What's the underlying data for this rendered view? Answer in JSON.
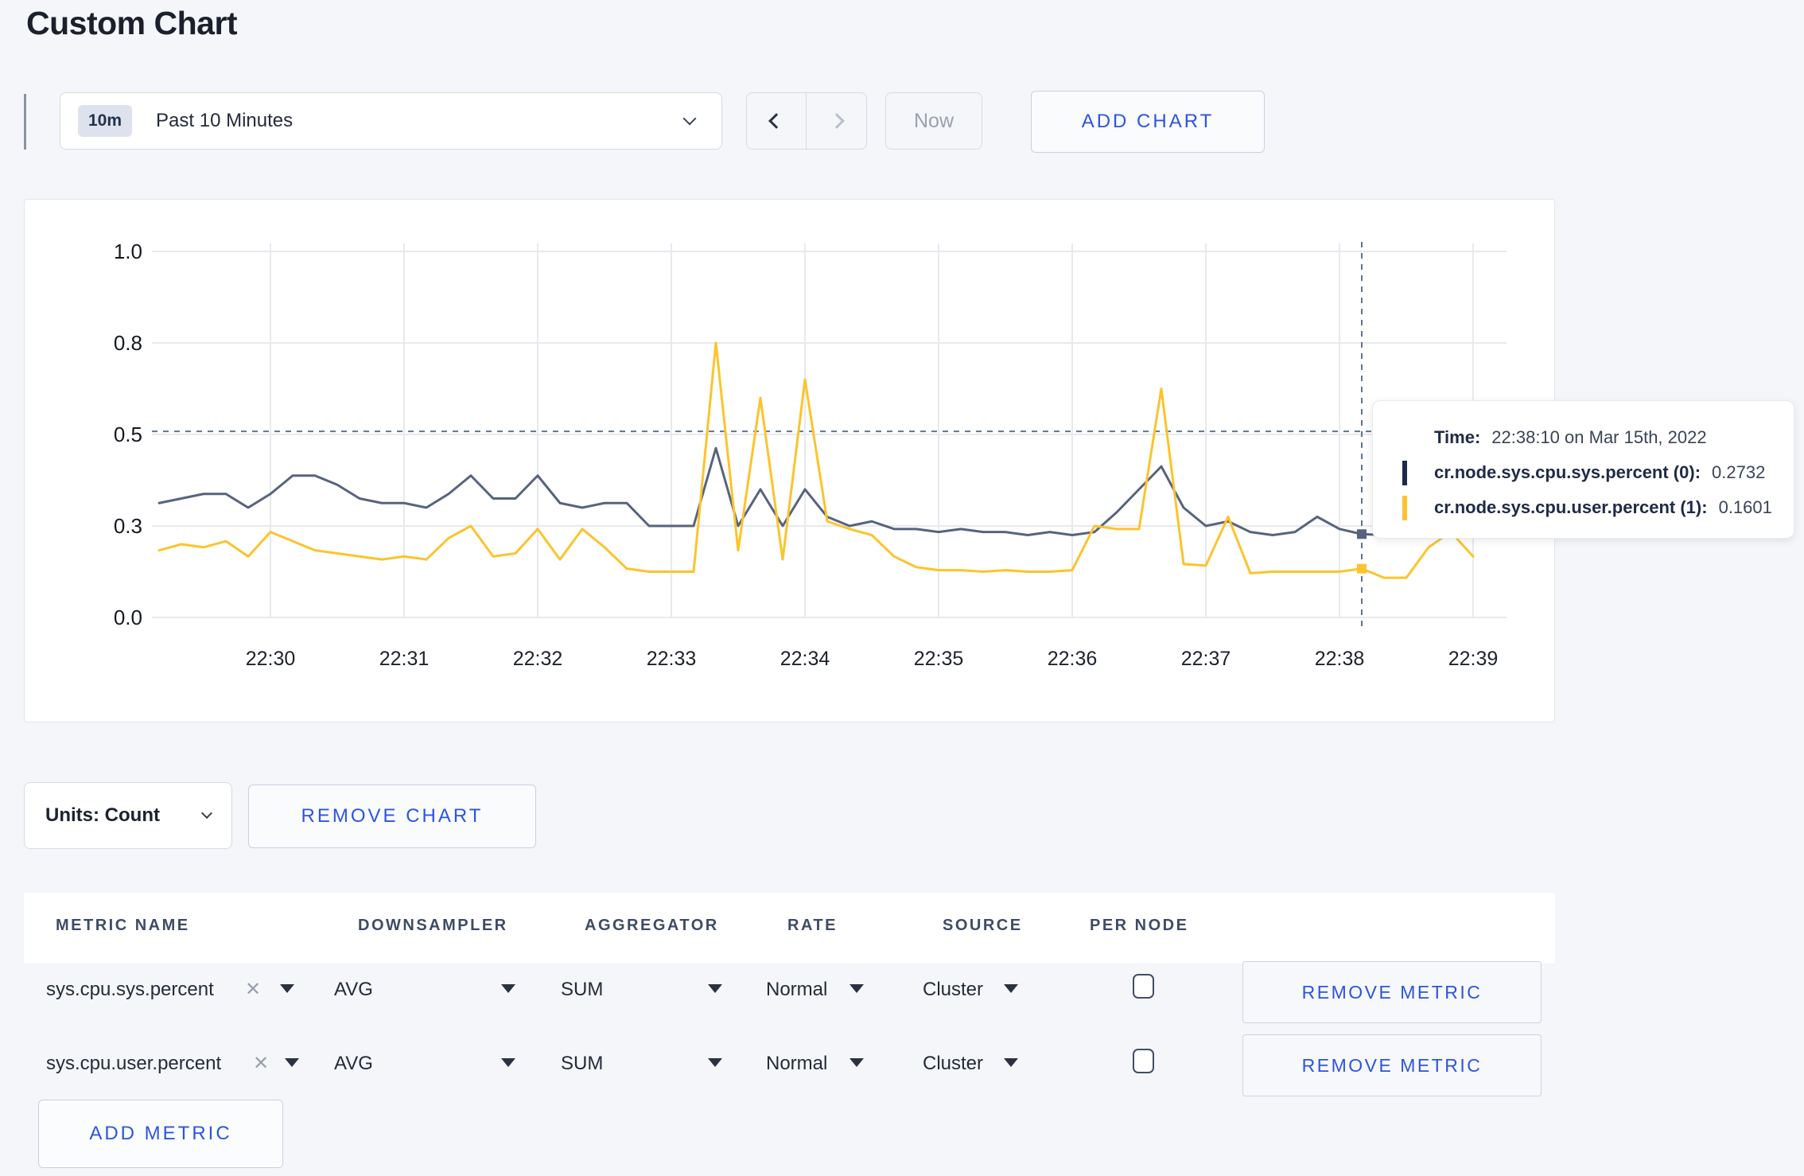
{
  "page": {
    "title": "Custom Chart"
  },
  "toolbar": {
    "time_badge": "10m",
    "time_label": "Past 10 Minutes",
    "now_label": "Now",
    "add_chart_label": "ADD CHART"
  },
  "chart": {
    "tooltip": {
      "time_label": "Time:",
      "time_value": "22:38:10 on Mar 15th, 2022",
      "series": [
        {
          "label": "cr.node.sys.cpu.sys.percent (0):",
          "value": "0.2732",
          "swatch_color": "#1f2a48"
        },
        {
          "label": "cr.node.sys.cpu.user.percent (1):",
          "value": "0.1601",
          "swatch_color": "#fdc32f"
        }
      ]
    }
  },
  "units_bar": {
    "units_label": "Units: Count",
    "remove_chart_label": "REMOVE CHART"
  },
  "metrics_table": {
    "columns": [
      "METRIC NAME",
      "DOWNSAMPLER",
      "AGGREGATOR",
      "RATE",
      "SOURCE",
      "PER NODE"
    ],
    "rows": [
      {
        "metric": "sys.cpu.sys.percent",
        "downsampler": "AVG",
        "aggregator": "SUM",
        "rate": "Normal",
        "source": "Cluster",
        "per_node_checked": false,
        "remove_label": "REMOVE METRIC"
      },
      {
        "metric": "sys.cpu.user.percent",
        "downsampler": "AVG",
        "aggregator": "SUM",
        "rate": "Normal",
        "source": "Cluster",
        "per_node_checked": false,
        "remove_label": "REMOVE METRIC"
      }
    ],
    "add_metric_label": "ADD METRIC"
  },
  "icons": {
    "close_x": "✕"
  },
  "colors": {
    "accent_blue": "#2b54e2",
    "series_sys": "#57637e",
    "series_user": "#fcc42c",
    "crosshair": "#5f7590",
    "grid": "#e7e9ee"
  },
  "chart_data": {
    "type": "line",
    "title": "",
    "xlabel": "",
    "ylabel": "",
    "grid": true,
    "legend_position": "tooltip",
    "x_start": "22:29:10",
    "x_interval_seconds": 10,
    "x_tick_labels": [
      "22:30",
      "22:31",
      "22:32",
      "22:33",
      "22:34",
      "22:35",
      "22:36",
      "22:37",
      "22:38",
      "22:39"
    ],
    "y_tick_labels": [
      "1.0",
      "0.8",
      "0.5",
      "0.3",
      "0.0"
    ],
    "ylim": [
      0.0,
      1.0
    ],
    "series": [
      {
        "name": "cr.node.sys.cpu.sys.percent",
        "color": "#57637e",
        "values": [
          0.35,
          0.36,
          0.37,
          0.37,
          0.34,
          0.37,
          0.41,
          0.41,
          0.39,
          0.36,
          0.35,
          0.35,
          0.34,
          0.37,
          0.41,
          0.36,
          0.36,
          0.41,
          0.35,
          0.34,
          0.35,
          0.35,
          0.3,
          0.3,
          0.3,
          0.47,
          0.3,
          0.38,
          0.3,
          0.38,
          0.32,
          0.3,
          0.31,
          0.29,
          0.29,
          0.28,
          0.29,
          0.28,
          0.28,
          0.27,
          0.28,
          0.27,
          0.28,
          0.33,
          0.38,
          0.43,
          0.34,
          0.3,
          0.31,
          0.28,
          0.27,
          0.28,
          0.32,
          0.29,
          0.2732,
          0.27,
          0.28,
          0.29,
          0.28,
          0.29
        ]
      },
      {
        "name": "cr.node.sys.cpu.user.percent",
        "color": "#fcc42c",
        "values": [
          0.22,
          0.24,
          0.23,
          0.25,
          0.2,
          0.28,
          0.25,
          0.22,
          0.21,
          0.2,
          0.19,
          0.2,
          0.19,
          0.26,
          0.3,
          0.2,
          0.21,
          0.29,
          0.19,
          0.29,
          0.23,
          0.16,
          0.15,
          0.15,
          0.15,
          0.8,
          0.22,
          0.62,
          0.19,
          0.68,
          0.31,
          0.29,
          0.27,
          0.2,
          0.165,
          0.155,
          0.155,
          0.15,
          0.155,
          0.15,
          0.15,
          0.155,
          0.3,
          0.29,
          0.29,
          0.65,
          0.175,
          0.17,
          0.32,
          0.145,
          0.15,
          0.15,
          0.15,
          0.15,
          0.1601,
          0.13,
          0.13,
          0.23,
          0.28,
          0.2
        ]
      }
    ],
    "crosshair": {
      "index": 54,
      "time": "22:38:10 on Mar 15th, 2022",
      "values": [
        0.2732,
        0.1601
      ],
      "hline_value": 0.51
    }
  }
}
